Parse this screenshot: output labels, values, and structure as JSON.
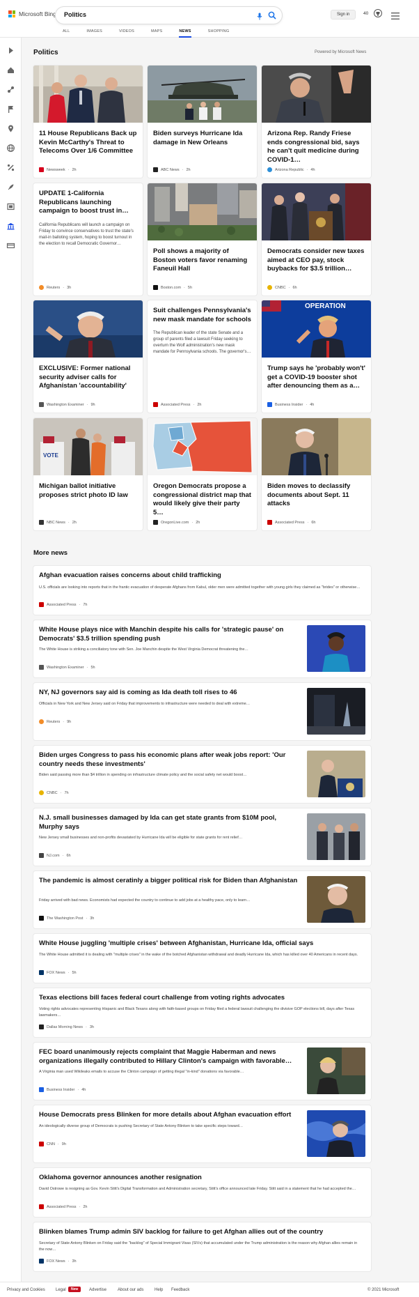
{
  "header": {
    "brand": "Microsoft Bing",
    "search_value": "Politics",
    "signin": "Sign in",
    "points": "40",
    "tabs": [
      {
        "label": "ALL"
      },
      {
        "label": "IMAGES"
      },
      {
        "label": "VIDEOS"
      },
      {
        "label": "MAPS"
      },
      {
        "label": "NEWS"
      },
      {
        "label": "SHOPPING"
      }
    ],
    "active_tab": "NEWS",
    "accent": "#174ae4"
  },
  "section": {
    "title": "Politics",
    "powered_by": "Powered by Microsoft News"
  },
  "cards": [
    {
      "title": "11 House Republicans Back up Kevin McCarthy's Threat to Telecoms Over 1/6 Committee",
      "snippet": "",
      "source": "Newsweek",
      "time": "2h",
      "src_color": "#d6001c"
    },
    {
      "title": "Biden surveys Hurricane Ida damage in New Orleans",
      "snippet": "",
      "source": "ABC News",
      "time": "2h",
      "src_color": "#222222"
    },
    {
      "title": "Arizona Rep. Randy Friese ends congressional bid, says he can't quit medicine during COVID-1…",
      "snippet": "",
      "source": "Arizona Republic",
      "time": "4h",
      "src_color": "#2d8fd8"
    },
    {
      "title": "UPDATE 1-California Republicans launching campaign to boost trust in…",
      "snippet": "California Republicans will launch a campaign on Friday to convince conservatives to trust the state's mail-in balloting system, hoping to boost turnout in the election to recall Democratic Governor…",
      "source": "Reuters",
      "time": "3h",
      "src_color": "#f28c28"
    },
    {
      "title": "Poll shows a majority of Boston voters favor renaming Faneuil Hall",
      "snippet": "",
      "source": "Boston.com",
      "time": "5h",
      "src_color": "#111111"
    },
    {
      "title": "Democrats consider new taxes aimed at CEO pay, stock buybacks for $3.5 trillion…",
      "snippet": "",
      "source": "CNBC",
      "time": "6h",
      "src_color": "#e8b400"
    },
    {
      "title": "EXCLUSIVE: Former national security adviser calls for Afghanistan 'accountability'",
      "snippet": "",
      "source": "Washington Examiner",
      "time": "9h",
      "src_color": "#555555"
    },
    {
      "title": "Suit challenges Pennsylvania's new mask mandate for schools",
      "snippet": "The Republican leader of the state Senate and a group of parents filed a lawsuit Friday seeking to overturn the Wolf administration's new mask mandate for Pennsylvania schools. The governor's…",
      "source": "Associated Press",
      "time": "2h",
      "src_color": "#cc0000"
    },
    {
      "title": "Trump says he 'probably won't' get a COVID-19 booster shot after denouncing them as a…",
      "snippet": "",
      "source": "Business Insider",
      "time": "4h",
      "src_color": "#1a5fe3"
    },
    {
      "title": "Michigan ballot initiative proposes strict photo ID law",
      "snippet": "",
      "source": "NBC News",
      "time": "2h",
      "src_color": "#333333"
    },
    {
      "title": "Oregon Democrats propose a congressional district map that would likely give their party 5…",
      "snippet": "",
      "source": "OregonLive.com",
      "time": "2h",
      "src_color": "#222222"
    },
    {
      "title": "Biden moves to declassify documents about Sept. 11 attacks",
      "snippet": "",
      "source": "Associated Press",
      "time": "6h",
      "src_color": "#cc0000"
    }
  ],
  "operation_sign": "OPERATION",
  "ballot_sign": "VOTE",
  "more_news": {
    "title": "More news",
    "items": [
      {
        "title": "Afghan evacuation raises concerns about child trafficking",
        "snippet": "U.S. officials are looking into reports that in the frantic evacuation of desperate Afghans from Kabul, older men were admitted together with young girls they claimed as \"brides\" or otherwise…",
        "source": "Associated Press",
        "time": "7h",
        "src_color": "#cc0000"
      },
      {
        "title": "White House plays nice with Manchin despite his calls for 'strategic pause' on Democrats' $3.5 trillion spending push",
        "snippet": "The White House is striking a conciliatory tone with Sen. Joe Manchin despite the West Virginia Democrat threatening the…",
        "source": "Washington Examiner",
        "time": "5h",
        "src_color": "#555555"
      },
      {
        "title": "NY, NJ governors say aid is coming as Ida death toll rises to 46",
        "snippet": "Officials in New York and New Jersey said on Friday that improvements to infrastructure were needed to deal with extreme…",
        "source": "Reuters",
        "time": "9h",
        "src_color": "#f28c28"
      },
      {
        "title": "Biden urges Congress to pass his economic plans after weak jobs report: 'Our country needs these investments'",
        "snippet": "Biden said passing more than $4 trillion in spending on infrastructure climate policy and the social safety net would boost…",
        "source": "CNBC",
        "time": "7h",
        "src_color": "#e8b400"
      },
      {
        "title": "N.J. small businesses damaged by Ida can get state grants from $10M pool, Murphy says",
        "snippet": "New Jersey small businesses and non-profits devastated by Hurricane Ida will be eligible for state grants for rent relief…",
        "source": "NJ.com",
        "time": "6h",
        "src_color": "#444444"
      },
      {
        "title": "The pandemic is almost ceratinly a bigger political risk for Biden than Afghanistan",
        "snippet": "Friday arrived with bad news. Economists had expected the country to continue to add jobs at a healthy pace, only to learn…",
        "source": "The Washington Post",
        "time": "3h",
        "src_color": "#111111"
      },
      {
        "title": "White House juggling 'multiple crises' between Afghanistan, Hurricane Ida, official says",
        "snippet": "The White House admitted it is dealing with \"multiple crises\" in the wake of the botched Afghanistan withdrawal and deadly Hurricane Ida, which has killed over 40 Americans in recent days.",
        "source": "FOX News",
        "time": "5h",
        "src_color": "#003366"
      },
      {
        "title": "Texas elections bill faces federal court challenge from voting rights advocates",
        "snippet": "Voting rights advocates representing Hispanic and Black Texans along with faith-based groups on Friday filed a federal lawsuit challenging the divisive GOP elections bill, days after Texas lawmakers…",
        "source": "Dallas Morning News",
        "time": "3h",
        "src_color": "#222222"
      },
      {
        "title": "FEC board unanimously rejects complaint that Maggie Haberman and news organizations illegally contributed to Hillary Clinton's campaign with favorable…",
        "snippet": "A Virginia man used Wikileaks emails to accuse the Clinton campaign of getting illegal \"in-kind\" donations via favorable…",
        "source": "Business Insider",
        "time": "4h",
        "src_color": "#1a5fe3"
      },
      {
        "title": "House Democrats press Blinken for more details about Afghan evacuation effort",
        "snippet": "An ideologically diverse group of Democrats is pushing Secretary of State Antony Blinken to take specific steps toward…",
        "source": "CNN",
        "time": "9h",
        "src_color": "#cc0000"
      },
      {
        "title": "Oklahoma governor announces another resignation",
        "snippet": "David Ostrowe is resigning as Gov. Kevin Stitt's Digital Transformation and Administration secretary, Stitt's office announced late Friday. Stitt said in a statement that he had accepted the…",
        "source": "Associated Press",
        "time": "2h",
        "src_color": "#cc0000"
      },
      {
        "title": "Blinken blames Trump admin SIV backlog for failure to get Afghan allies out of the country",
        "snippet": "Secretary of State Antony Blinken on Friday said the \"backlog\" of Special Immigrant Visas (SIVs) that accumulated under the Trump administration is the reason why Afghan allies remain in the now…",
        "source": "FOX News",
        "time": "3h",
        "src_color": "#003366"
      }
    ]
  },
  "footer": {
    "links": [
      "Privacy and Cookies",
      "Legal",
      "Advertise",
      "About our ads",
      "Help",
      "Feedback"
    ],
    "new_badge": "New",
    "copyright": "© 2021 Microsoft"
  }
}
